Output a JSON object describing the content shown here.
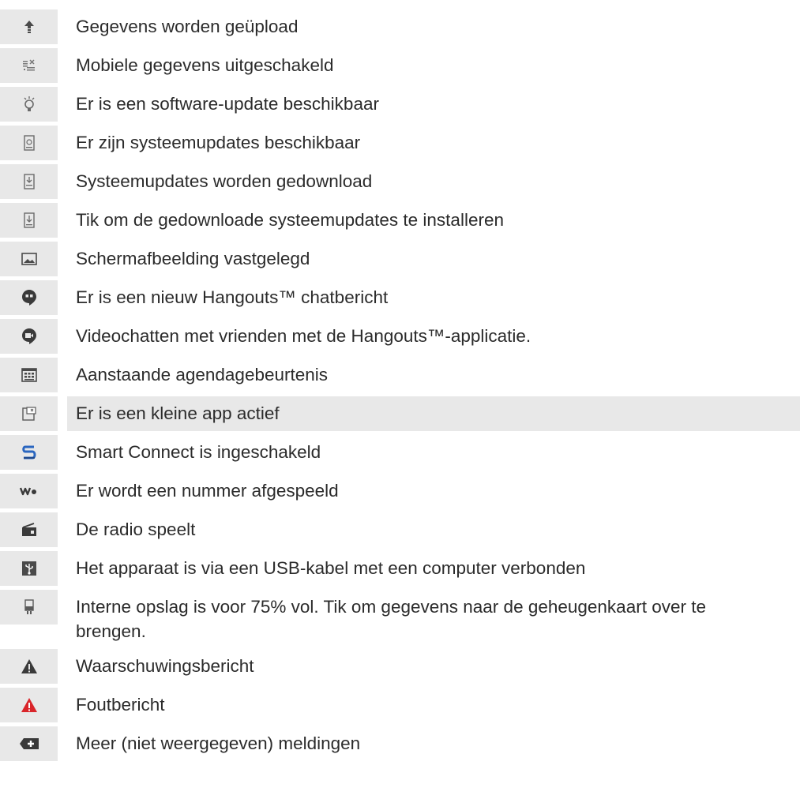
{
  "rows": [
    {
      "icon": "upload-icon",
      "text": "Gegevens worden geüpload",
      "highlighted": false
    },
    {
      "icon": "mobile-data-off-icon",
      "text": "Mobiele gegevens uitgeschakeld",
      "highlighted": false
    },
    {
      "icon": "lightbulb-icon",
      "text": "Er is een software-update beschikbaar",
      "highlighted": false
    },
    {
      "icon": "system-update-icon",
      "text": "Er zijn systeemupdates beschikbaar",
      "highlighted": false
    },
    {
      "icon": "system-update-downloading-icon",
      "text": "Systeemupdates worden gedownload",
      "highlighted": false
    },
    {
      "icon": "system-update-install-icon",
      "text": "Tik om de gedownloade systeemupdates te installeren",
      "highlighted": false
    },
    {
      "icon": "screenshot-icon",
      "text": "Schermafbeelding vastgelegd",
      "highlighted": false
    },
    {
      "icon": "hangouts-chat-icon",
      "text": "Er is een nieuw Hangouts™ chatbericht",
      "highlighted": false
    },
    {
      "icon": "hangouts-video-icon",
      "text": "Videochatten met vrienden met de Hangouts™-applicatie.",
      "highlighted": false
    },
    {
      "icon": "calendar-icon",
      "text": "Aanstaande agendagebeurtenis",
      "highlighted": false
    },
    {
      "icon": "small-app-icon",
      "text": "Er is een kleine app actief",
      "highlighted": true
    },
    {
      "icon": "smart-connect-icon",
      "text": "Smart Connect is ingeschakeld",
      "highlighted": false
    },
    {
      "icon": "walkman-icon",
      "text": "Er wordt een nummer afgespeeld",
      "highlighted": false
    },
    {
      "icon": "radio-icon",
      "text": "De radio speelt",
      "highlighted": false
    },
    {
      "icon": "usb-icon",
      "text": "Het apparaat is via een USB-kabel met een computer verbonden",
      "highlighted": false
    },
    {
      "icon": "storage-icon",
      "text": "Interne opslag is voor 75% vol. Tik om gegevens naar de geheugenkaart over te",
      "text2": "brengen.",
      "highlighted": false
    },
    {
      "icon": "warning-icon",
      "text": "Waarschuwingsbericht",
      "highlighted": false
    },
    {
      "icon": "error-icon",
      "text": "Foutbericht",
      "highlighted": false
    },
    {
      "icon": "more-notifications-icon",
      "text": "Meer (niet weergegeven) meldingen",
      "highlighted": false
    }
  ],
  "colors": {
    "icon_cell": "#e8e8e8",
    "text": "#2b2b2b",
    "icon": "#4a4a4a",
    "error": "#d9252a",
    "smart_connect": "#2a66c0"
  }
}
